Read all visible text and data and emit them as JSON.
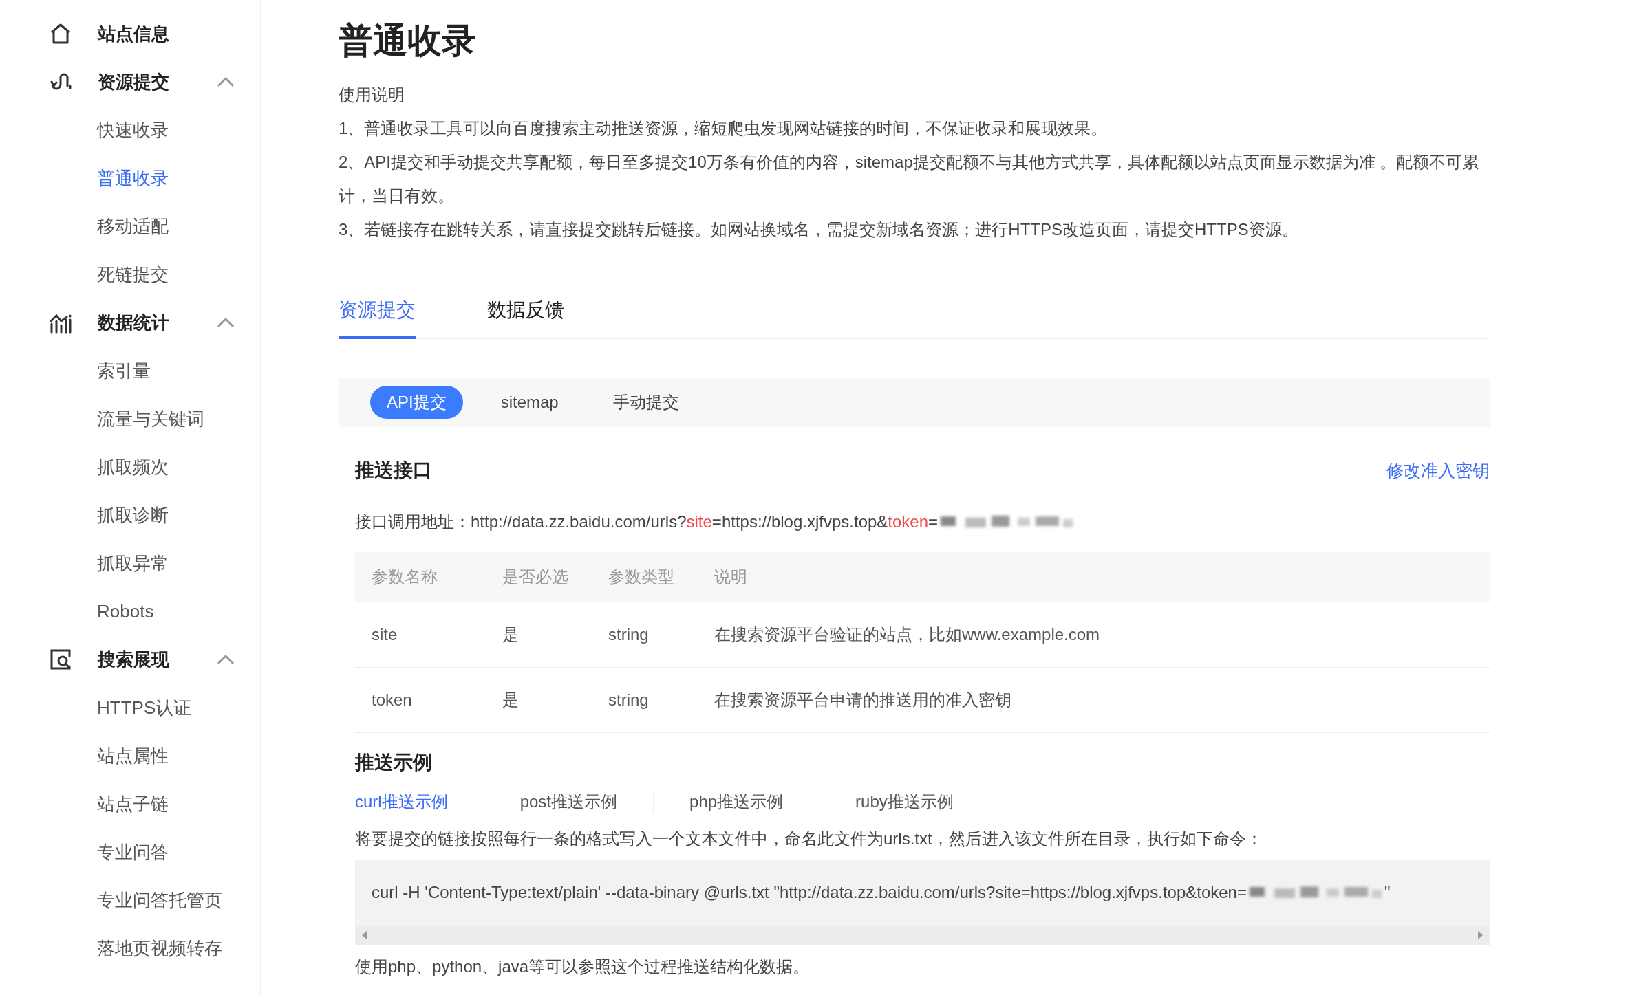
{
  "sidebar": {
    "groups": [
      {
        "label": "站点信息"
      },
      {
        "label": "资源提交",
        "expanded": true,
        "children": [
          {
            "label": "快速收录",
            "selected": false
          },
          {
            "label": "普通收录",
            "selected": true
          },
          {
            "label": "移动适配",
            "selected": false
          },
          {
            "label": "死链提交",
            "selected": false
          }
        ]
      },
      {
        "label": "数据统计",
        "expanded": true,
        "children": [
          {
            "label": "索引量",
            "selected": false
          },
          {
            "label": "流量与关键词",
            "selected": false
          },
          {
            "label": "抓取频次",
            "selected": false
          },
          {
            "label": "抓取诊断",
            "selected": false
          },
          {
            "label": "抓取异常",
            "selected": false
          },
          {
            "label": "Robots",
            "selected": false
          }
        ]
      },
      {
        "label": "搜索展现",
        "expanded": true,
        "children": [
          {
            "label": "HTTPS认证",
            "selected": false
          },
          {
            "label": "站点属性",
            "selected": false
          },
          {
            "label": "站点子链",
            "selected": false
          },
          {
            "label": "专业问答",
            "selected": false
          },
          {
            "label": "专业问答托管页",
            "selected": false
          },
          {
            "label": "落地页视频转存",
            "selected": false
          }
        ]
      }
    ]
  },
  "page": {
    "title": "普通收录",
    "usage_heading": "使用说明",
    "usage": [
      "1、普通收录工具可以向百度搜索主动推送资源，缩短爬虫发现网站链接的时间，不保证收录和展现效果。",
      "2、API提交和手动提交共享配额，每日至多提交10万条有价值的内容，sitemap提交配额不与其他方式共享，具体配额以站点页面显示数据为准 。配额不可累计，当日有效。",
      "3、若链接存在跳转关系，请直接提交跳转后链接。如网站换域名，需提交新域名资源；进行HTTPS改造页面，请提交HTTPS资源。"
    ]
  },
  "tabs": [
    {
      "label": "资源提交",
      "selected": true
    },
    {
      "label": "数据反馈",
      "selected": false
    }
  ],
  "subtabs": [
    {
      "label": "API提交",
      "selected": true
    },
    {
      "label": "sitemap",
      "selected": false
    },
    {
      "label": "手动提交",
      "selected": false
    }
  ],
  "push_api": {
    "heading": "推送接口",
    "link": "修改准入密钥",
    "url_parts": [
      {
        "text": "接口调用地址：http://data.zz.baidu.com/urls?",
        "highlighted": false
      },
      {
        "text": "site",
        "highlighted": true
      },
      {
        "text": "=https://blog.xjfvps.top&",
        "highlighted": false
      },
      {
        "text": "token",
        "highlighted": true
      },
      {
        "text": "=",
        "highlighted": false
      }
    ]
  },
  "table": {
    "columns": [
      "参数名称",
      "是否必选",
      "参数类型",
      "说明"
    ],
    "rows": [
      [
        "site",
        "是",
        "string",
        "在搜索资源平台验证的站点，比如www.example.com"
      ],
      [
        "token",
        "是",
        "string",
        "在搜索资源平台申请的推送用的准入密钥"
      ]
    ]
  },
  "examples": {
    "heading": "推送示例",
    "tabs": [
      {
        "label": "curl推送示例",
        "selected": true
      },
      {
        "label": "post推送示例",
        "selected": false
      },
      {
        "label": "php推送示例",
        "selected": false
      },
      {
        "label": "ruby推送示例",
        "selected": false
      }
    ],
    "description": "将要提交的链接按照每行一条的格式写入一个文本文件中，命名此文件为urls.txt，然后进入该文件所在目录，执行如下命令：",
    "code_before": "curl -H 'Content-Type:text/plain' --data-binary @urls.txt \"http://data.zz.baidu.com/urls?site=https://blog.xjfvps.top&token=",
    "code_after": "\"",
    "note": "使用php、python、java等可以参照这个过程推送结构化数据。"
  }
}
